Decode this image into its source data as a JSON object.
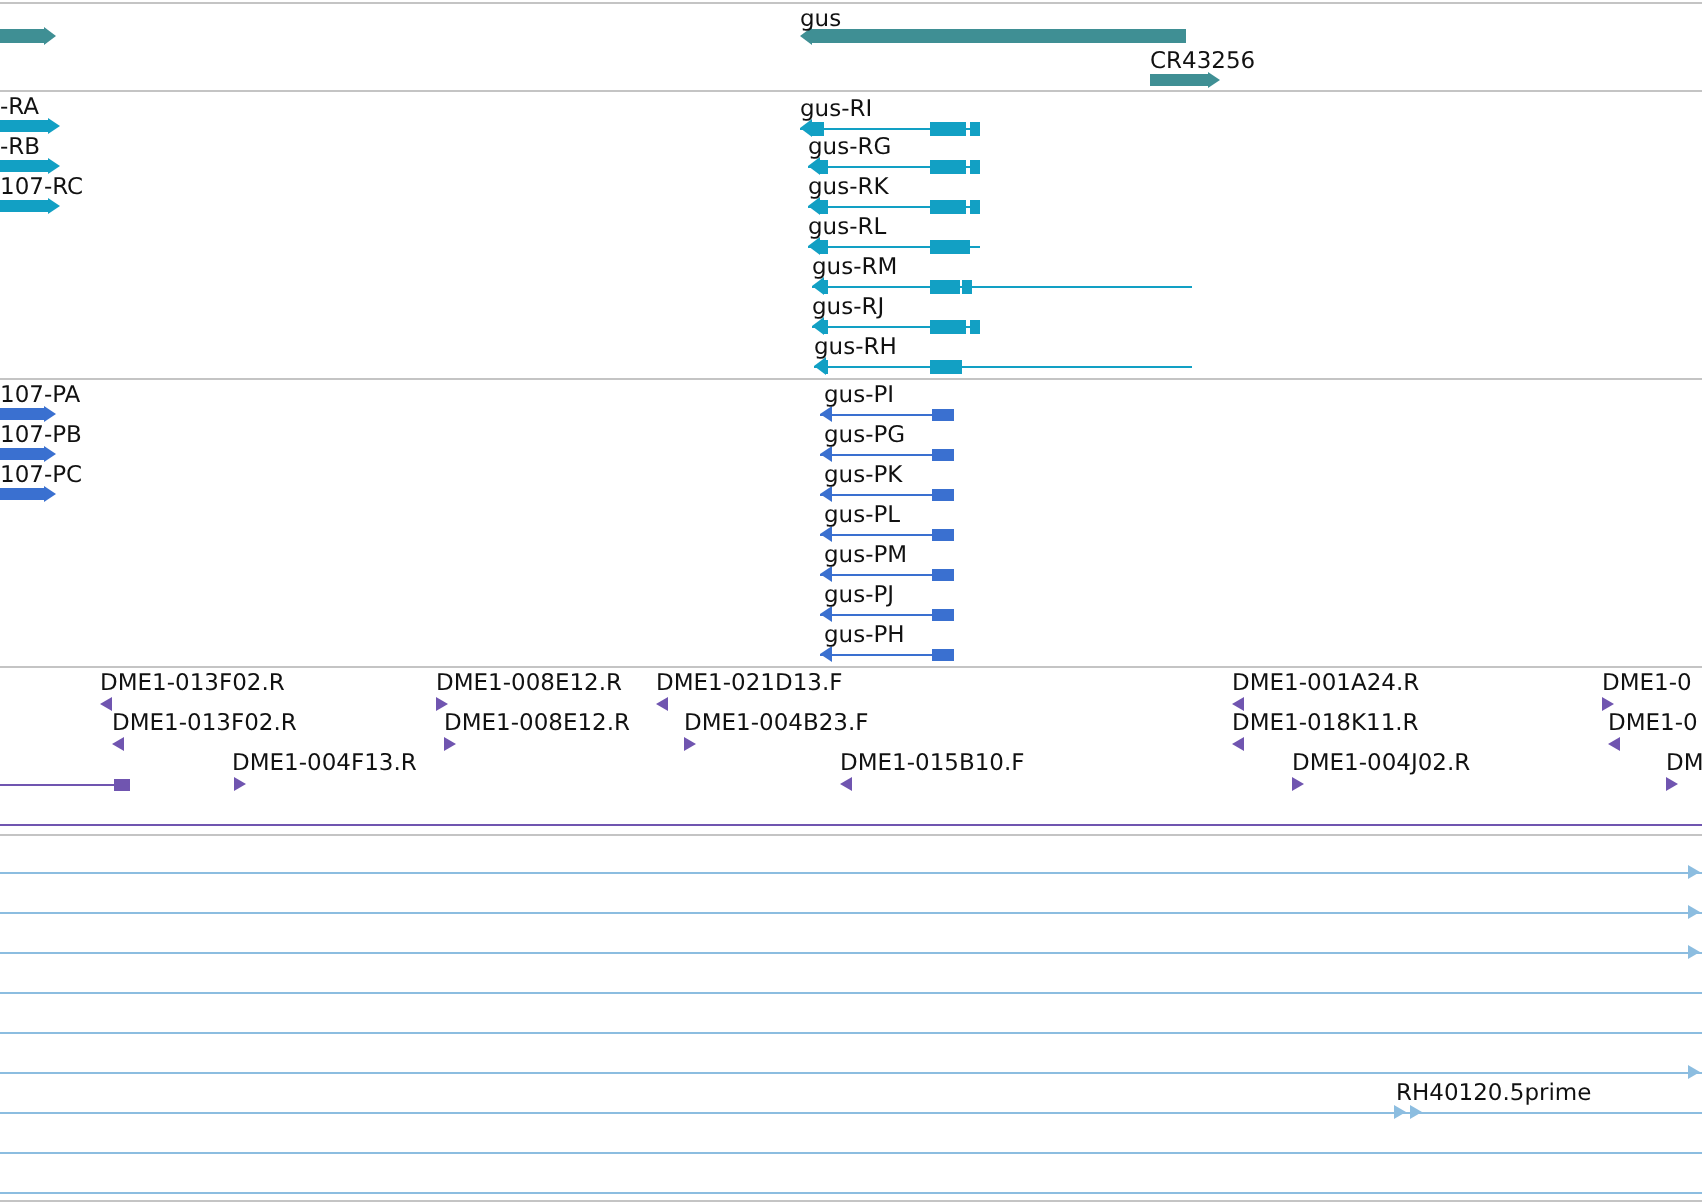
{
  "tracks": [
    {
      "color": "#3f8f94",
      "features": [
        {
          "reverse": false
        },
        {
          "label": "gus",
          "reverse": true
        },
        {
          "label": "CR43256",
          "reverse": false
        }
      ]
    },
    {
      "color": "#12a0c4",
      "features": [
        {
          "label": "-RA",
          "reverse": false
        },
        {
          "label": "-RB",
          "reverse": false
        },
        {
          "label": "107-RC",
          "reverse": false
        },
        {
          "label": "gus-RI",
          "reverse": true
        },
        {
          "label": "gus-RG",
          "reverse": true
        },
        {
          "label": "gus-RK",
          "reverse": true
        },
        {
          "label": "gus-RL",
          "reverse": true
        },
        {
          "label": "gus-RM",
          "reverse": true
        },
        {
          "label": "gus-RJ",
          "reverse": true
        },
        {
          "label": "gus-RH",
          "reverse": true
        }
      ]
    },
    {
      "color": "#3a70d0",
      "features": [
        {
          "label": "107-PA",
          "reverse": false
        },
        {
          "label": "107-PB",
          "reverse": false
        },
        {
          "label": "107-PC",
          "reverse": false
        },
        {
          "label": "gus-PI",
          "reverse": true
        },
        {
          "label": "gus-PG",
          "reverse": true
        },
        {
          "label": "gus-PK",
          "reverse": true
        },
        {
          "label": "gus-PL",
          "reverse": true
        },
        {
          "label": "gus-PM",
          "reverse": true
        },
        {
          "label": "gus-PJ",
          "reverse": true
        },
        {
          "label": "gus-PH",
          "reverse": true
        }
      ]
    },
    {
      "color": "#7055b0",
      "features": [
        {
          "label": "DME1-013F02.R",
          "reverse": true
        },
        {
          "label": "DME1-013F02.R",
          "reverse": true
        },
        {
          "label": "DME1-004F13.R",
          "reverse": false
        },
        {
          "label": "DME1-008E12.R",
          "reverse": false
        },
        {
          "label": "DME1-008E12.R",
          "reverse": false
        },
        {
          "label": "DME1-021D13.F",
          "reverse": true
        },
        {
          "label": "DME1-004B23.F",
          "reverse": false
        },
        {
          "label": "DME1-015B10.F",
          "reverse": true
        },
        {
          "label": "DME1-001A24.R",
          "reverse": true
        },
        {
          "label": "DME1-018K11.R",
          "reverse": true
        },
        {
          "label": "DME1-004J02.R",
          "reverse": false
        },
        {
          "label": "DME1-0",
          "reverse": false
        },
        {
          "label": "DME1-0",
          "reverse": true
        },
        {
          "label": "DM",
          "reverse": false
        }
      ]
    },
    {
      "color": "#8cbde0",
      "features": [
        {
          "reverse": false
        },
        {
          "reverse": false
        },
        {
          "reverse": false
        },
        {
          "reverse": false
        },
        {
          "label": "RH40120.5prime",
          "reverse": false
        }
      ]
    }
  ]
}
